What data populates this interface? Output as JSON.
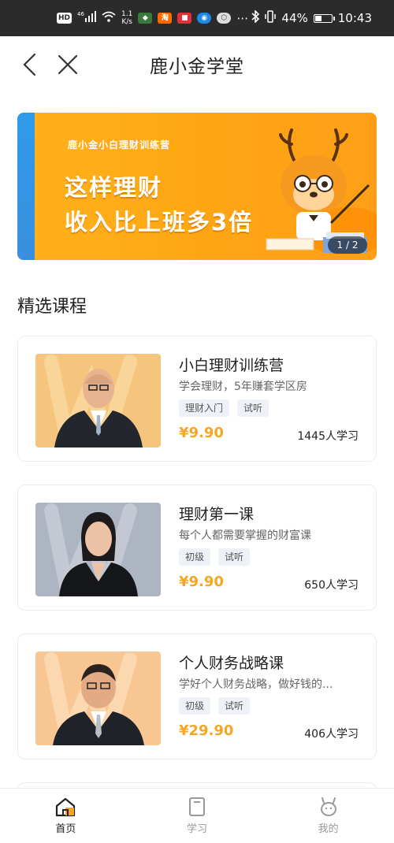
{
  "status_bar": {
    "network": "46",
    "speed_value": "1.1",
    "speed_unit": "K/s",
    "battery_percent": 44,
    "battery_text": "44%",
    "time": "10:43"
  },
  "header": {
    "title": "鹿小金学堂"
  },
  "banner": {
    "subtitle": "鹿小金小白理财训练营",
    "line1": "这样理财",
    "line2": "收入比上班多3倍",
    "indicator": "1 / 2"
  },
  "section": {
    "title": "精选课程"
  },
  "courses": [
    {
      "title": "小白理财训练营",
      "subtitle": "学会理财，5年赚套学区房",
      "tags": [
        "理财入门",
        "试听"
      ],
      "price": "¥9.90",
      "learners": "1445人学习"
    },
    {
      "title": "理财第一课",
      "subtitle": "每个人都需要掌握的财富课",
      "tags": [
        "初级",
        "试听"
      ],
      "price": "¥9.90",
      "learners": "650人学习"
    },
    {
      "title": "个人财务战略课",
      "subtitle": "学好个人财务战略，做好钱的...",
      "tags": [
        "初级",
        "试听"
      ],
      "price": "¥29.90",
      "learners": "406人学习"
    }
  ],
  "tabbar": {
    "items": [
      {
        "label": "首页",
        "icon": "home-icon",
        "active": true
      },
      {
        "label": "学习",
        "icon": "book-icon",
        "active": false
      },
      {
        "label": "我的",
        "icon": "deer-profile-icon",
        "active": false
      }
    ]
  },
  "colors": {
    "accent": "#f5a623",
    "banner": "#ffa514",
    "statusbar": "#2b2b2b"
  }
}
